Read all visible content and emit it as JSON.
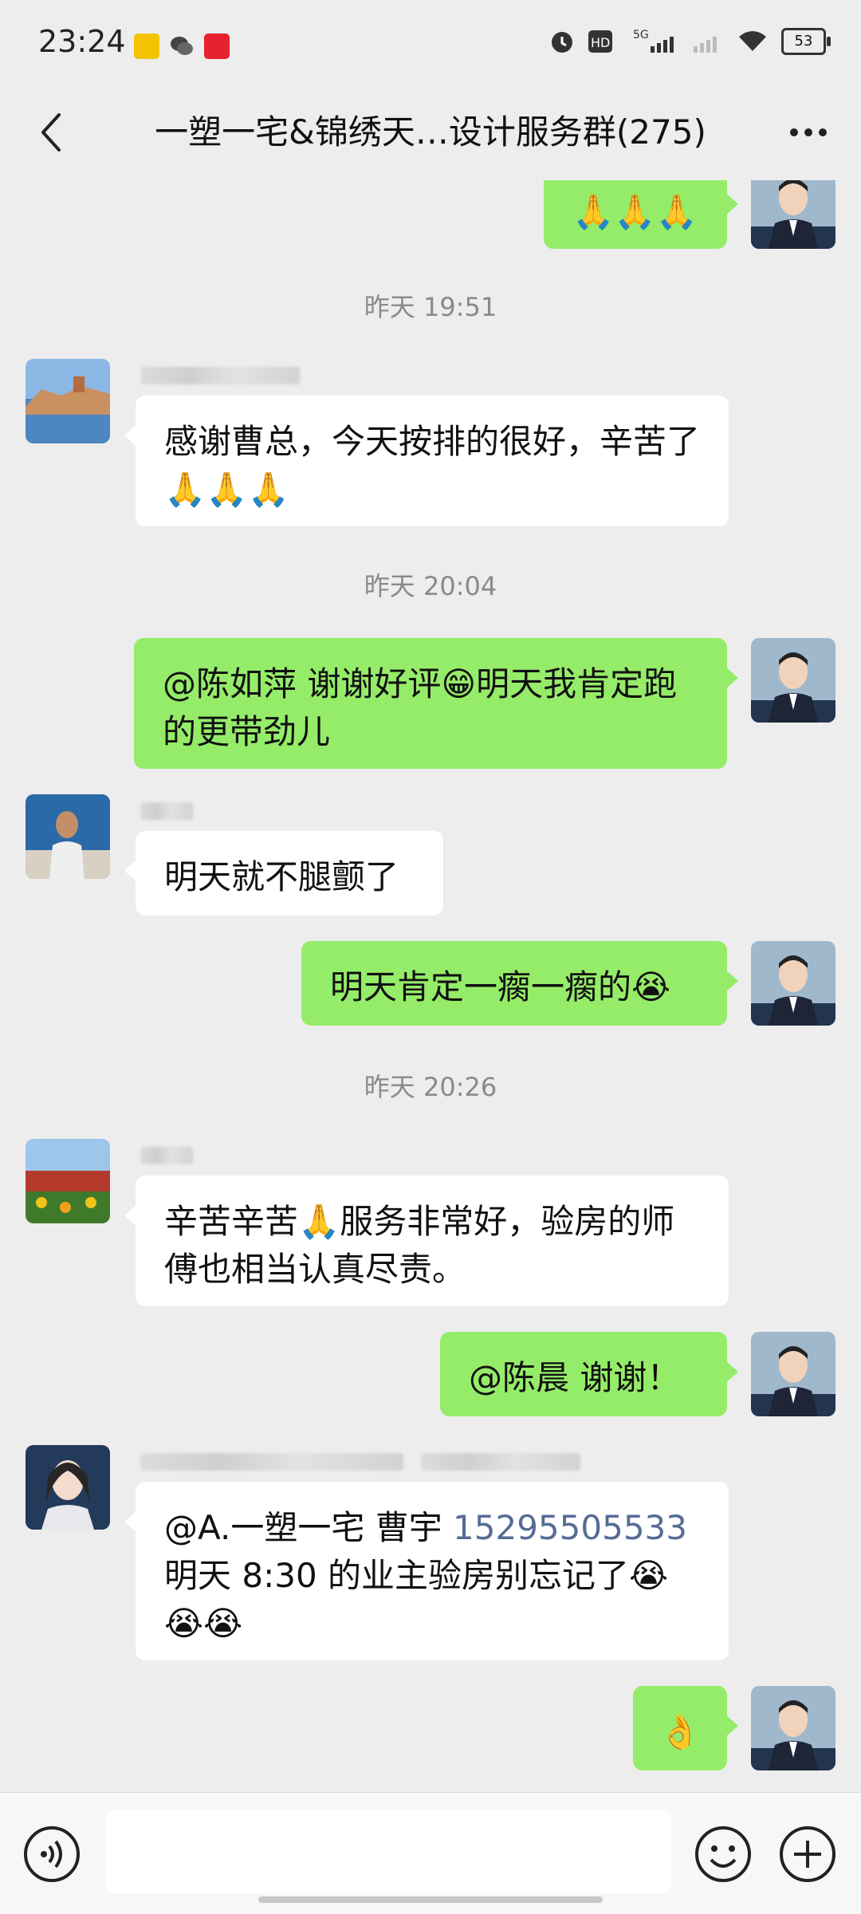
{
  "status_bar": {
    "time": "23:24",
    "network": "5G",
    "battery": "53"
  },
  "header": {
    "title": "一塑一宅&锦绣天…设计服务群(275)"
  },
  "messages": [
    {
      "type": "out",
      "text": "🙏🙏🙏"
    },
    {
      "type": "time",
      "text": "昨天 19:51"
    },
    {
      "type": "in",
      "text": "感谢曹总，今天按排的很好，辛苦了🙏🙏🙏"
    },
    {
      "type": "time",
      "text": "昨天 20:04"
    },
    {
      "type": "out",
      "text": "@陈如萍  谢谢好评😁明天我肯定跑的更带劲儿"
    },
    {
      "type": "in",
      "text": "明天就不腿颤了"
    },
    {
      "type": "out",
      "text": "明天肯定一瘸一瘸的😭"
    },
    {
      "type": "time",
      "text": "昨天 20:26"
    },
    {
      "type": "in",
      "text": "辛苦辛苦🙏服务非常好，验房的师傅也相当认真尽责。"
    },
    {
      "type": "out",
      "text": "@陈晨  谢谢！"
    },
    {
      "type": "in",
      "mention": "@A.一塑一宅 曹宇 ",
      "phone": "15295505533",
      "rest": "明天 8:30 的业主验房别忘记了😭😭😭"
    },
    {
      "type": "out",
      "text": "👌"
    }
  ],
  "icons": {
    "back": "back-arrow-icon",
    "more": "more-dots-icon",
    "voice": "voice-icon",
    "emoji": "emoji-icon",
    "plus": "plus-icon"
  },
  "colors": {
    "outgoing_bubble": "#95ec69",
    "incoming_bubble": "#ffffff",
    "background": "#ededed",
    "link": "#576b95"
  }
}
